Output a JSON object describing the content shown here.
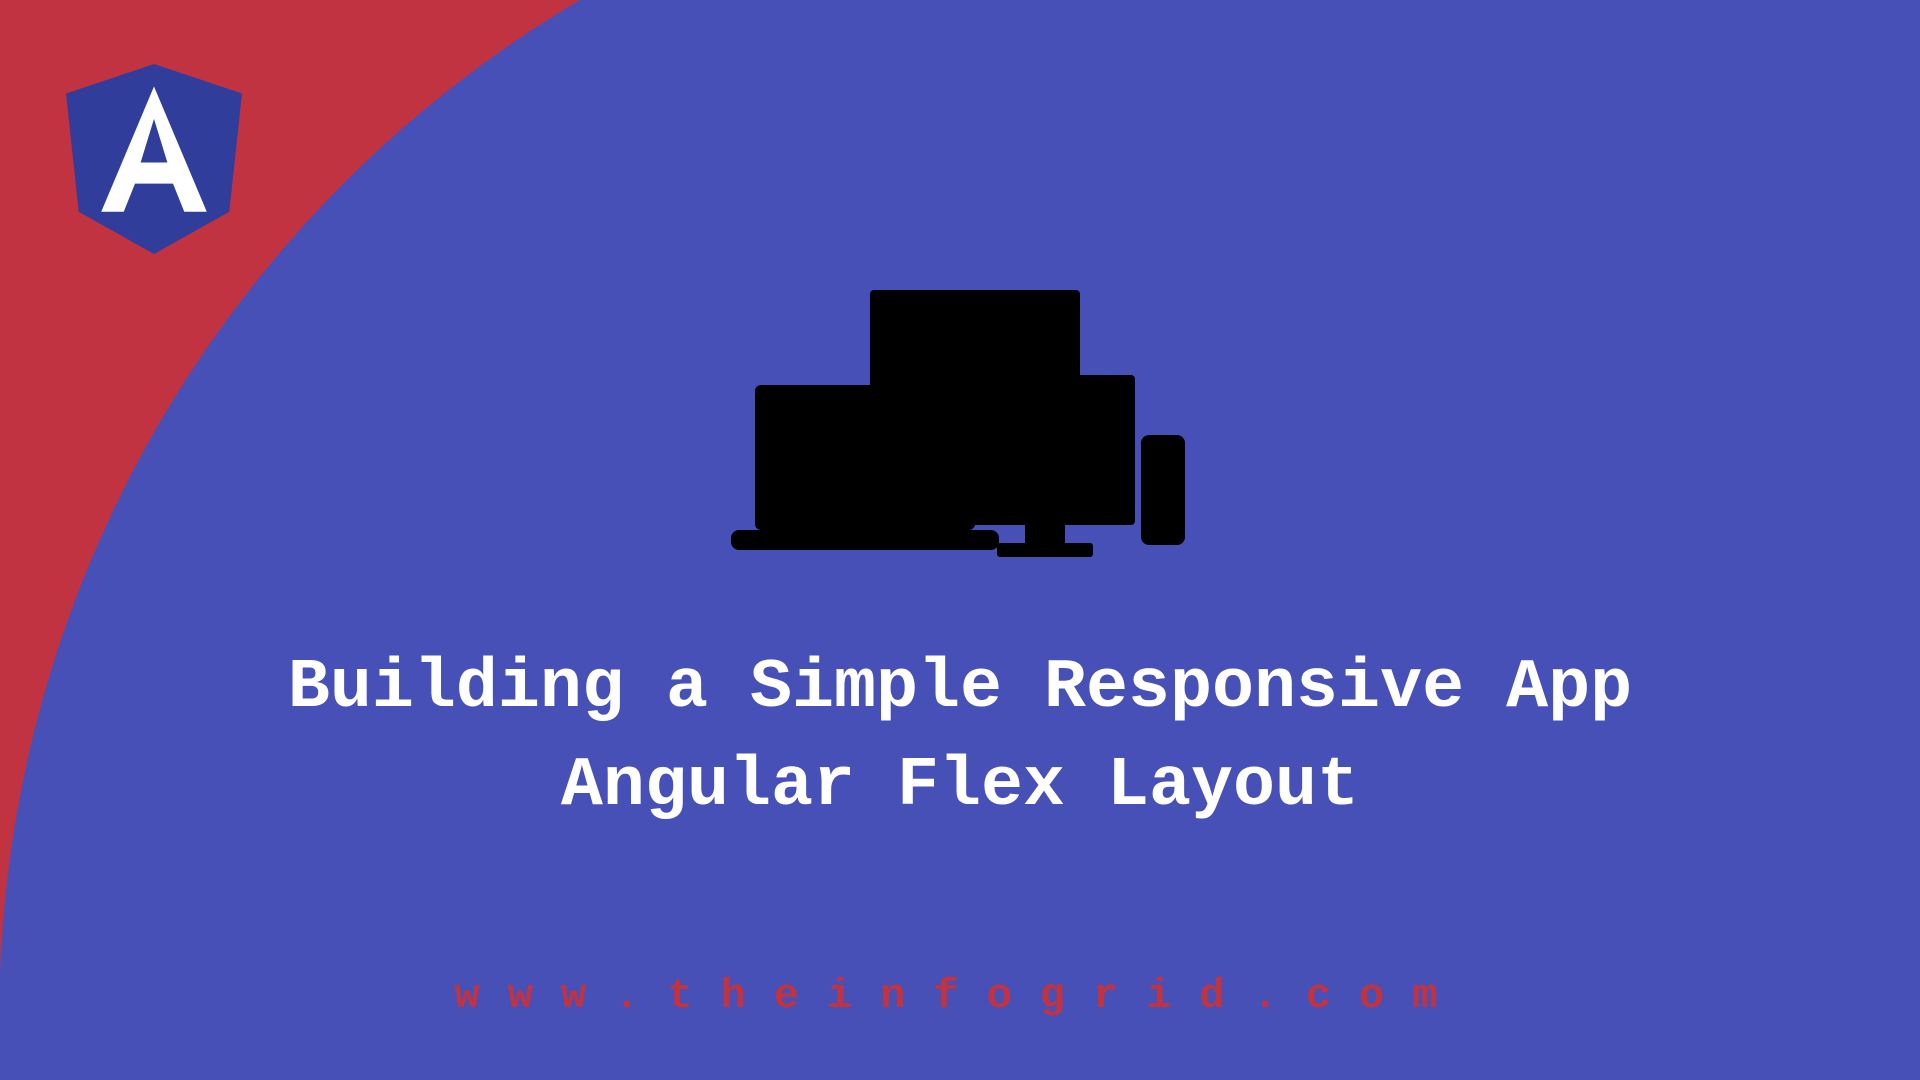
{
  "title_line1": "Building a Simple Responsive App",
  "title_line2": "Angular Flex Layout",
  "footer_url": "www.theinfogrid.com",
  "colors": {
    "background_blue": "#4750b7",
    "accent_red": "#c13341",
    "logo_blue": "#303d9a",
    "text_white": "#ffffff"
  },
  "icons": {
    "logo": "angular-logo",
    "center": "responsive-devices"
  }
}
